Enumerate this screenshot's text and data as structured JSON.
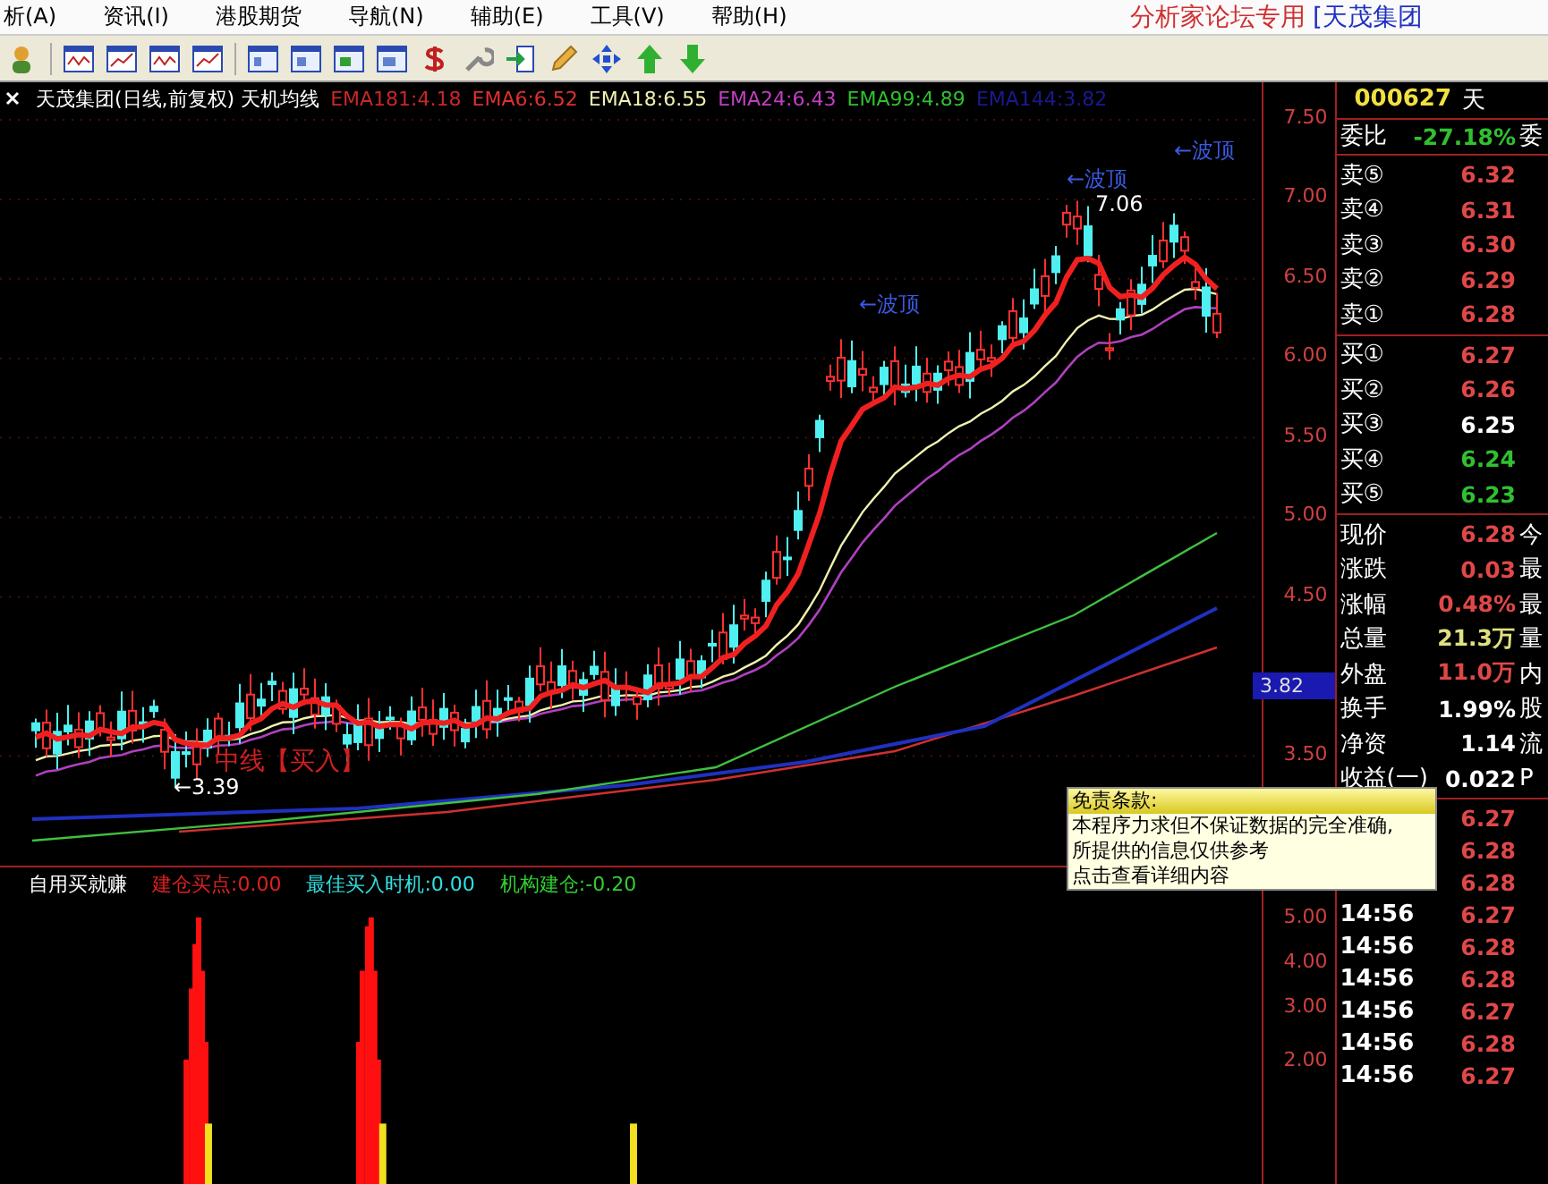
{
  "menu_bar": {
    "items": [
      "析(A)",
      "资讯(I)",
      "港股期货",
      "导航(N)",
      "辅助(E)",
      "工具(V)",
      "帮助(H)"
    ],
    "title": "分析家论坛专用",
    "stock_tag": "[天茂集团"
  },
  "chart": {
    "title": "天茂集团(日线,前复权) 天机均线",
    "indicators": [
      {
        "label": "EMA181:4.18",
        "color": "#c82828"
      },
      {
        "label": "EMA6:6.52",
        "color": "#e03030"
      },
      {
        "label": "EMA18:6.55",
        "color": "#f0f0b0"
      },
      {
        "label": "EMA24:6.43",
        "color": "#c040c0"
      },
      {
        "label": "EMA99:4.89",
        "color": "#30c030"
      },
      {
        "label": "EMA144:3.82",
        "color": "#1a1a90"
      }
    ],
    "price_axis": [
      "7.50",
      "7.00",
      "6.50",
      "6.00",
      "5.50",
      "5.00",
      "4.50",
      "3.50"
    ],
    "current_price_tag": "3.82",
    "annotations": [
      {
        "kind": "peak",
        "text": "←波顶"
      },
      {
        "kind": "high",
        "text": "7.06"
      },
      {
        "kind": "peak",
        "text": "←波顶"
      },
      {
        "kind": "peak",
        "text": "←波顶"
      },
      {
        "kind": "buy",
        "text": "中线【买入】"
      },
      {
        "kind": "low",
        "text": "←3.39"
      }
    ]
  },
  "indicator_panel": {
    "name": "自用买就赚",
    "values": [
      {
        "label": "建仓买点:0.00",
        "color": "#e02020"
      },
      {
        "label": "最佳买入时机:0.00",
        "color": "#30e0e0"
      },
      {
        "label": "机构建仓:-0.20",
        "color": "#30d030"
      }
    ],
    "axis": [
      "5.00",
      "4.00",
      "3.00",
      "2.00"
    ]
  },
  "quote_panel": {
    "code": "000627",
    "name": "天",
    "ratio": {
      "label": "委比",
      "value": "-27.18%",
      "color": "#30c030",
      "extra": "委"
    },
    "asks": [
      {
        "label": "卖⑤",
        "price": "6.32",
        "color": "#e04848"
      },
      {
        "label": "卖④",
        "price": "6.31",
        "color": "#e04848"
      },
      {
        "label": "卖③",
        "price": "6.30",
        "color": "#e04848"
      },
      {
        "label": "卖②",
        "price": "6.29",
        "color": "#e04848"
      },
      {
        "label": "卖①",
        "price": "6.28",
        "color": "#e04848"
      }
    ],
    "bids": [
      {
        "label": "买①",
        "price": "6.27",
        "color": "#e04848"
      },
      {
        "label": "买②",
        "price": "6.26",
        "color": "#e04848"
      },
      {
        "label": "买③",
        "price": "6.25",
        "color": "#ffffff"
      },
      {
        "label": "买④",
        "price": "6.24",
        "color": "#30c030"
      },
      {
        "label": "买⑤",
        "price": "6.23",
        "color": "#30c030"
      }
    ],
    "stats": [
      {
        "label": "现价",
        "value": "6.28",
        "color": "#e04848",
        "extra": "今"
      },
      {
        "label": "涨跌",
        "value": "0.03",
        "color": "#e04848",
        "extra": "最"
      },
      {
        "label": "涨幅",
        "value": "0.48%",
        "color": "#e04848",
        "extra": "最"
      },
      {
        "label": "总量",
        "value": "21.3万",
        "color": "#e0e080",
        "extra": "量"
      },
      {
        "label": "外盘",
        "value": "11.0万",
        "color": "#e04848",
        "extra": "内"
      },
      {
        "label": "换手",
        "value": "1.99%",
        "color": "#ffffff",
        "extra": "股"
      },
      {
        "label": "净资",
        "value": "1.14",
        "color": "#ffffff",
        "extra": "流"
      },
      {
        "label": "收益(一)",
        "value": "0.022",
        "color": "#ffffff",
        "extra": "P"
      }
    ],
    "ticks": [
      {
        "price": "6.27",
        "color": "#e04848"
      },
      {
        "price": "6.28",
        "color": "#e04848"
      },
      {
        "price": "6.28",
        "color": "#e04848"
      },
      {
        "time": "14:56",
        "price": "6.27",
        "color": "#e04848"
      },
      {
        "time": "14:56",
        "price": "6.28",
        "color": "#e04848"
      },
      {
        "time": "14:56",
        "price": "6.28",
        "color": "#e04848"
      },
      {
        "time": "14:56",
        "price": "6.27",
        "color": "#e04848"
      },
      {
        "time": "14:56",
        "price": "6.28",
        "color": "#e04848"
      },
      {
        "time": "14:56",
        "price": "6.27",
        "color": "#e04848"
      }
    ]
  },
  "disclaimer_tooltip": {
    "title": "免责条款:",
    "lines": [
      "本程序力求但不保证数据的完全准确,",
      "所提供的信息仅供参考",
      "点击查看详细内容"
    ]
  }
}
